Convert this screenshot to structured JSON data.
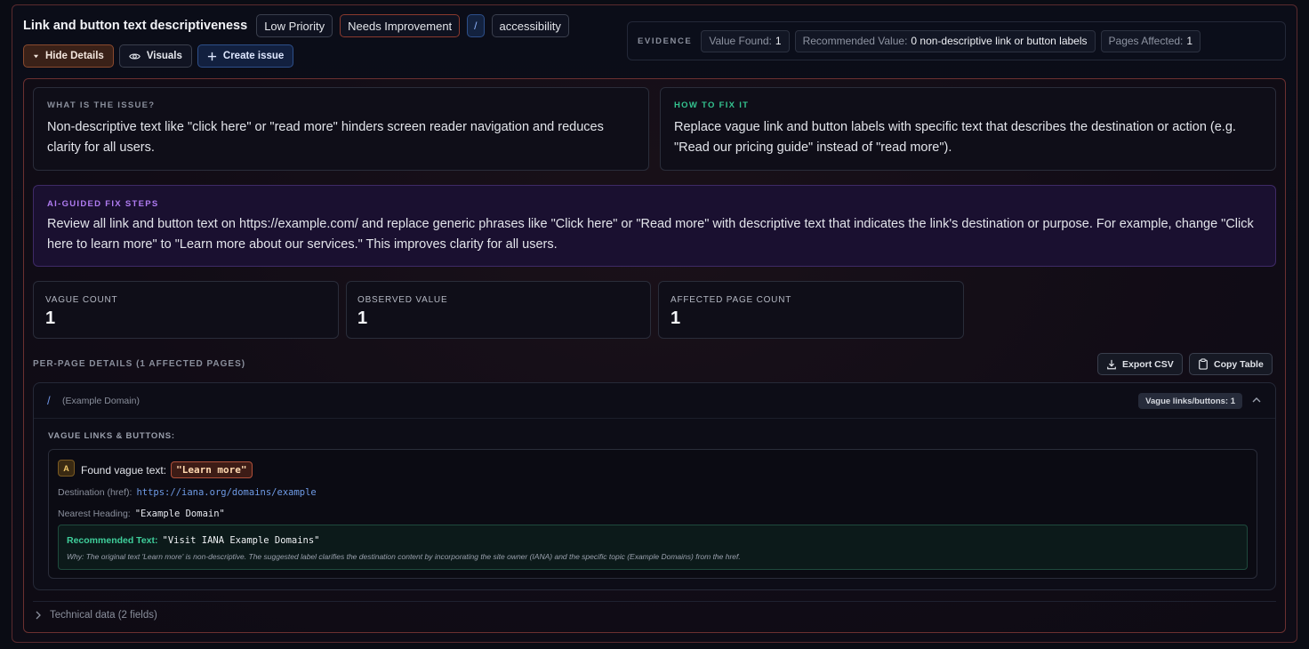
{
  "header": {
    "title": "Link and button text descriptiveness",
    "priority_badge": "Low Priority",
    "status_badge": "Needs Improvement",
    "path_badge": "/",
    "category_badge": "accessibility"
  },
  "actions": {
    "hide_details": "Hide Details",
    "visuals": "Visuals",
    "create_issue": "Create issue"
  },
  "evidence": {
    "label": "EVIDENCE",
    "value_found_label": "Value Found:",
    "value_found": "1",
    "recommended_label": "Recommended Value:",
    "recommended": "0 non-descriptive link or button labels",
    "pages_affected_label": "Pages Affected:",
    "pages_affected": "1"
  },
  "issue": {
    "header": "WHAT IS THE ISSUE?",
    "text": "Non-descriptive text like \"click here\" or \"read more\" hinders screen reader navigation and reduces clarity for all users."
  },
  "fix": {
    "header": "HOW TO FIX IT",
    "text": "Replace vague link and button labels with specific text that describes the destination or action (e.g. \"Read our pricing guide\" instead of \"read more\")."
  },
  "ai_steps": {
    "header": "AI-GUIDED FIX STEPS",
    "text": "Review all link and button text on https://example.com/ and replace generic phrases like \"Click here\" or \"Read more\" with descriptive text that indicates the link's destination or purpose. For example, change \"Click here to learn more\" to \"Learn more about our services.\" This improves clarity for all users."
  },
  "stats": [
    {
      "label": "VAGUE COUNT",
      "value": "1"
    },
    {
      "label": "OBSERVED VALUE",
      "value": "1"
    },
    {
      "label": "AFFECTED PAGE COUNT",
      "value": "1"
    }
  ],
  "per_page": {
    "title": "PER-PAGE DETAILS (1 AFFECTED PAGES)",
    "export_csv": "Export CSV",
    "copy_table": "Copy Table",
    "page": {
      "path": "/",
      "name": "(Example Domain)",
      "badge": "Vague links/buttons: 1",
      "section_title": "VAGUE LINKS & BUTTONS:",
      "finding": {
        "letter": "A",
        "found_label": "Found vague text:",
        "found_value": "\"Learn more\"",
        "dest_label": "Destination (href):",
        "dest_value": "https://iana.org/domains/example",
        "heading_label": "Nearest Heading:",
        "heading_value": "\"Example Domain\"",
        "rec_label": "Recommended Text:",
        "rec_value": "\"Visit IANA Example Domains\"",
        "why": "Why: The original text 'Learn more' is non-descriptive. The suggested label clarifies the destination content by incorporating the site owner (IANA) and the specific topic (Example Domains) from the href."
      }
    }
  },
  "technical": "Technical data (2 fields)",
  "colors": {
    "accent_blue": "#6f9be6",
    "fix_green": "#34c38f",
    "ai_purple": "#b07cf2",
    "warn_orange": "#b0503a"
  }
}
